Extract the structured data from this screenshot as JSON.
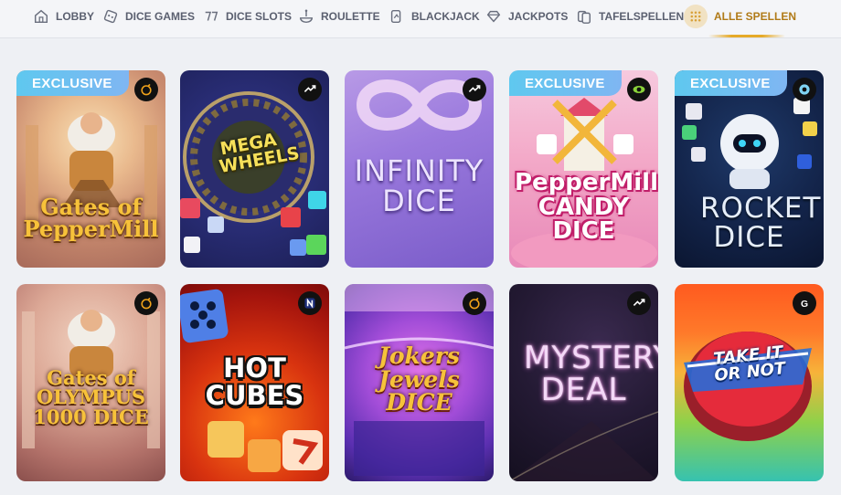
{
  "nav": {
    "items": [
      {
        "label": "LOBBY",
        "icon": "house-icon"
      },
      {
        "label": "DICE GAMES",
        "icon": "dice-icon"
      },
      {
        "label": "DICE SLOTS",
        "icon": "slot-seven-icon"
      },
      {
        "label": "ROULETTE",
        "icon": "roulette-wheel-icon"
      },
      {
        "label": "BLACKJACK",
        "icon": "playing-cards-icon"
      },
      {
        "label": "JACKPOTS",
        "icon": "diamond-icon"
      },
      {
        "label": "TAFELSPELLEN",
        "icon": "table-cards-icon"
      },
      {
        "label": "ALLE SPELLEN",
        "icon": "grid-dots-icon",
        "active": true
      }
    ],
    "accent_color": "#b07a17"
  },
  "games": [
    {
      "title": "Gates of PepperMill",
      "badge": "EXCLUSIVE",
      "provider_icon": "bomb-icon"
    },
    {
      "title": "MEGA WHEELS",
      "badge": "",
      "provider_icon": "rocket-arrow-icon"
    },
    {
      "title": "INFINITY DICE",
      "badge": "",
      "provider_icon": "rocket-arrow-icon"
    },
    {
      "title": "PepperMill CANDY DICE",
      "badge": "EXCLUSIVE",
      "provider_icon": "eye-icon"
    },
    {
      "title": "ROCKET DICE",
      "badge": "EXCLUSIVE",
      "provider_icon": "spiral-icon"
    },
    {
      "title": "Gates of OLYMPUS 1000 DICE",
      "badge": "",
      "provider_icon": "bomb-icon"
    },
    {
      "title": "HOT CUBES",
      "badge": "",
      "provider_icon": "n-logo-icon"
    },
    {
      "title": "Jokers Jewels DICE",
      "badge": "",
      "provider_icon": "bomb-icon"
    },
    {
      "title": "MYSTERY DEAL",
      "badge": "",
      "provider_icon": "rocket-arrow-icon"
    },
    {
      "title": "TAKE IT OR NOT",
      "badge": "",
      "provider_icon": "g-logo-icon"
    }
  ],
  "colors": {
    "badge": "#6ec0f0",
    "page_bg": "#eef0f4"
  }
}
